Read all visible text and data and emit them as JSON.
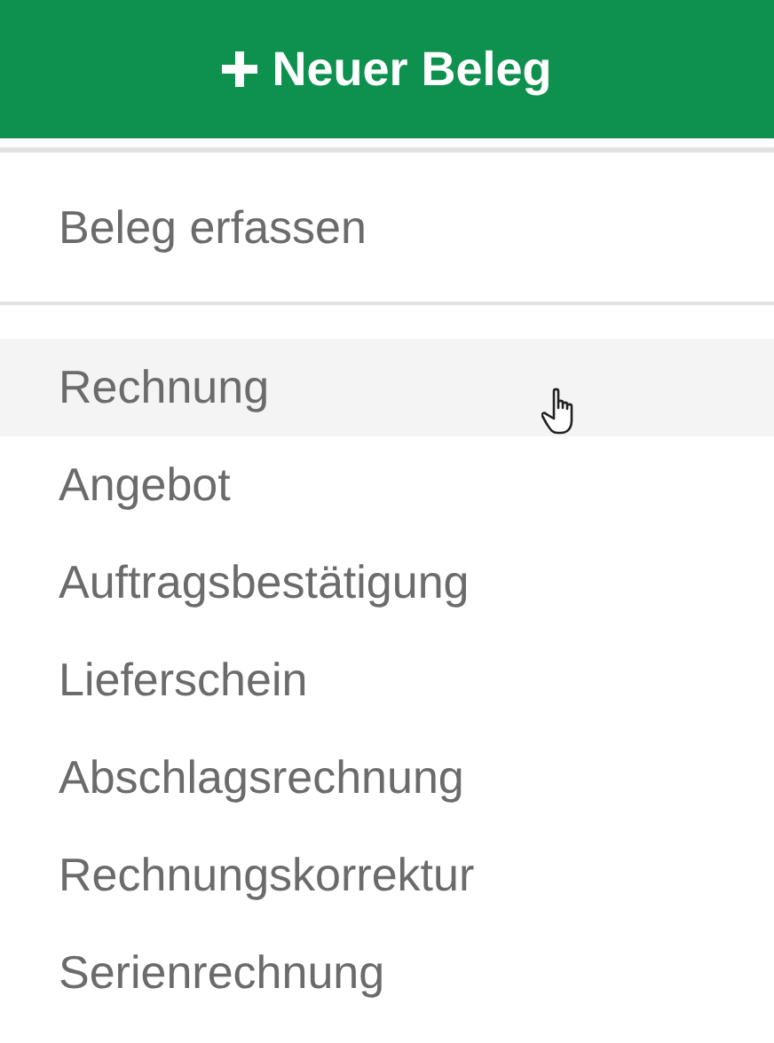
{
  "header_button": {
    "label": "Neuer Beleg"
  },
  "section": {
    "label": "Beleg erfassen"
  },
  "items": [
    {
      "label": "Rechnung",
      "hovered": true
    },
    {
      "label": "Angebot",
      "hovered": false
    },
    {
      "label": "Auftragsbestätigung",
      "hovered": false
    },
    {
      "label": "Lieferschein",
      "hovered": false
    },
    {
      "label": "Abschlagsrechnung",
      "hovered": false
    },
    {
      "label": "Rechnungskorrektur",
      "hovered": false
    },
    {
      "label": "Serienrechnung",
      "hovered": false
    }
  ]
}
